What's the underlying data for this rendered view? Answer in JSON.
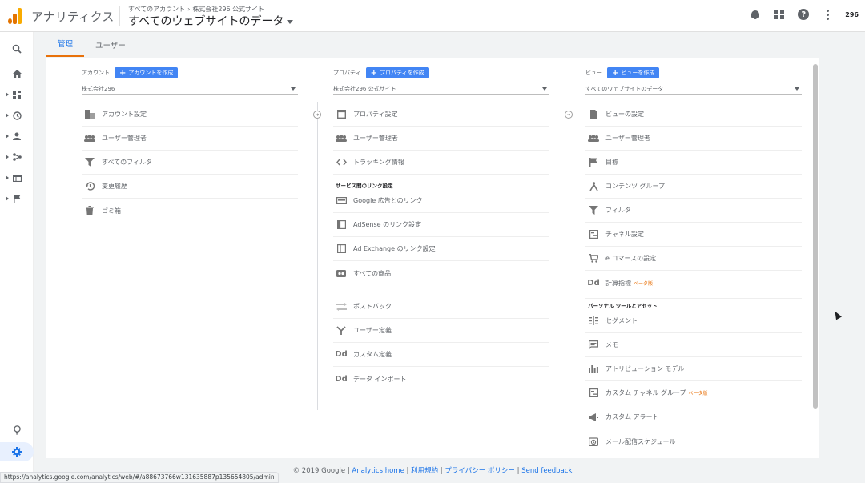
{
  "header": {
    "app_title": "アナリティクス",
    "breadcrumb": [
      "すべてのアカウント",
      "株式会社296 公式サイト"
    ],
    "property_title": "すべてのウェブサイトのデータ",
    "account_badge": "296",
    "icons": [
      "bell-icon",
      "apps-icon",
      "help-icon",
      "more-vert-icon"
    ],
    "logo_colors": [
      "#f9ab00",
      "#e37400",
      "#e37400"
    ]
  },
  "rail": {
    "icons": [
      "search-icon",
      "home-icon",
      "dashboard-icon",
      "clock-icon",
      "person-icon",
      "acquisition-icon",
      "behavior-icon",
      "flag-icon",
      "lightbulb-icon",
      "settings-icon"
    ]
  },
  "tabs": [
    {
      "label": "管理",
      "active": true
    },
    {
      "label": "ユーザー",
      "active": false
    }
  ],
  "columns": {
    "account": {
      "heading": "アカウント",
      "create_label": "アカウントを作成",
      "selected": "株式会社296",
      "items": [
        "アカウント設定",
        "ユーザー管理者",
        "すべてのフィルタ",
        "変更履歴",
        "ゴミ箱"
      ]
    },
    "property": {
      "heading": "プロパティ",
      "create_label": "プロパティを作成",
      "selected": "株式会社296 公式サイト",
      "items": [
        "プロパティ設定",
        "ユーザー管理者",
        "トラッキング情報"
      ],
      "section_label": "サービス間のリンク設定",
      "link_items": [
        "Google 広告とのリンク",
        "AdSense のリンク設定",
        "Ad Exchange のリンク設定",
        "すべての商品"
      ],
      "more_items": [
        "ポストバック",
        "ユーザー定義",
        "カスタム定義",
        "データ インポート"
      ]
    },
    "view": {
      "heading": "ビュー",
      "create_label": "ビューを作成",
      "selected": "すべてのウェブサイトのデータ",
      "items": [
        "ビューの設定",
        "ユーザー管理者",
        "目標",
        "コンテンツ グループ",
        "フィルタ",
        "チャネル設定",
        "e コマースの設定",
        "計算指標"
      ],
      "beta_label": "ベータ版",
      "section_label": "パーソナル ツールとアセット",
      "personal_items": [
        "セグメント",
        "メモ",
        "アトリビューション モデル",
        "カスタム チャネル グループ",
        "カスタム アラート",
        "メール配信スケジュール"
      ]
    }
  },
  "footer": {
    "copyright": "© 2019 Google",
    "links": [
      "Analytics home",
      "利用規約",
      "プライバシー ポリシー",
      "Send feedback"
    ]
  },
  "status_url": "https://analytics.google.com/analytics/web/#/a88673766w131635887p135654805/admin"
}
